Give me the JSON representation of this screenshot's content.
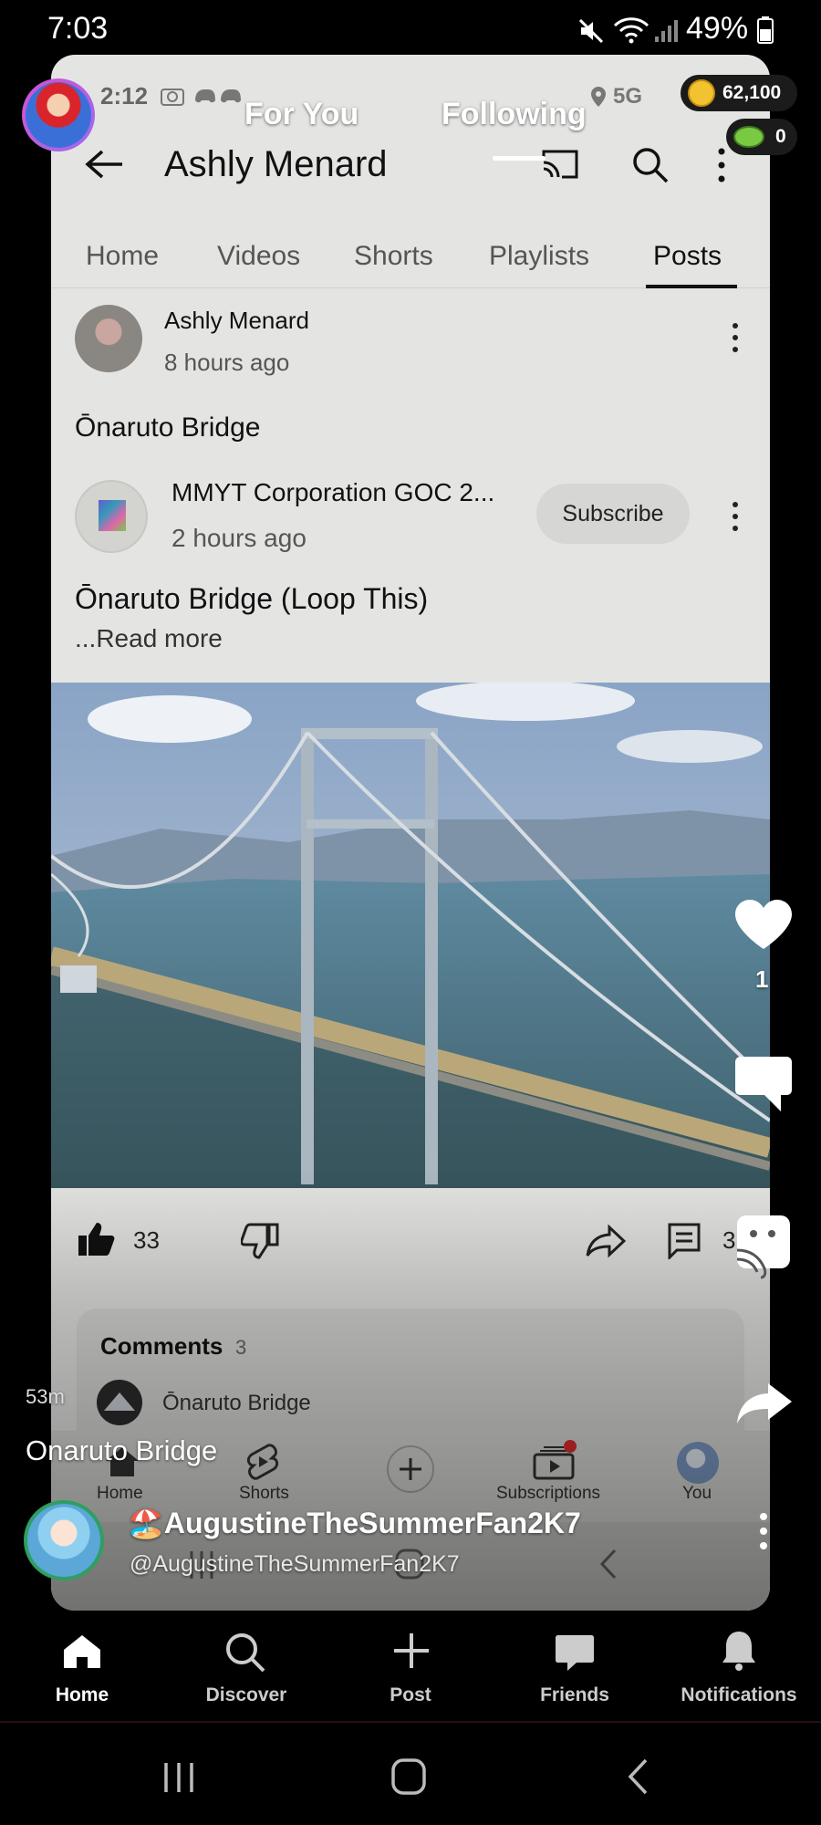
{
  "status_bar": {
    "time": "7:03",
    "battery": "49%"
  },
  "inner_status": {
    "time": "2:12",
    "network": "5G"
  },
  "feed_tabs": {
    "for_you": "For You",
    "following": "Following"
  },
  "coins": {
    "count": "62,100",
    "gems": "0"
  },
  "channel": {
    "name": "Ashly Menard"
  },
  "channel_tabs": [
    "Home",
    "Videos",
    "Shorts",
    "Playlists",
    "Posts"
  ],
  "post": {
    "author": "Ashly Menard",
    "time": "8 hours ago",
    "text": "Ōnaruto Bridge"
  },
  "shared": {
    "author": "MMYT Corporation GOC 2...",
    "time": "2 hours ago",
    "subscribe": "Subscribe",
    "text": "Ōnaruto Bridge (Loop This)",
    "read_more": "...Read more"
  },
  "actions": {
    "likes": "33",
    "comments_count": "3"
  },
  "comments": {
    "label": "Comments",
    "count": "3",
    "first": "Ōnaruto Bridge"
  },
  "inner_nav": {
    "home": "Home",
    "shorts": "Shorts",
    "subscriptions": "Subscriptions",
    "you": "You"
  },
  "right_rail": {
    "like_count": "1"
  },
  "video_info": {
    "age": "53m",
    "title": "Onaruto Bridge",
    "display_name": "🏖️AugustineTheSummerFan2K7",
    "handle": "@AugustineTheSummerFan2K7"
  },
  "bottom_nav": {
    "home": "Home",
    "discover": "Discover",
    "post": "Post",
    "friends": "Friends",
    "notifications": "Notifications"
  },
  "colors": {
    "accent_red": "#e02d2d",
    "card_bg": "#e4e5e3",
    "coin_gold": "#f2c230",
    "gem_green": "#7ac943"
  }
}
